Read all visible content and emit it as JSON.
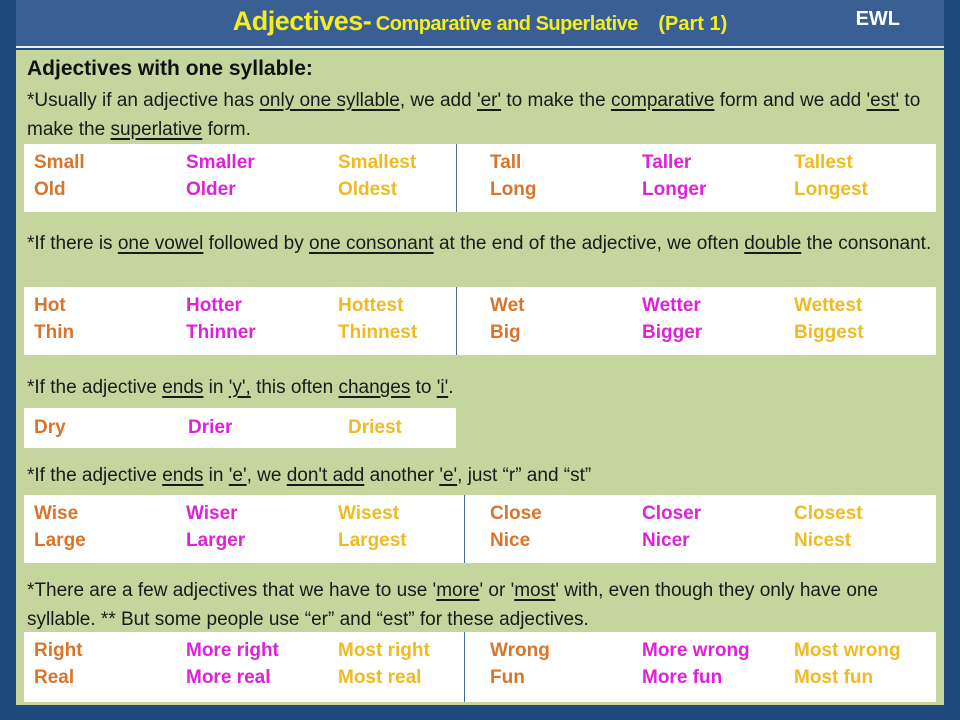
{
  "header": {
    "title_main": "Adjectives-",
    "title_sub": "Comparative and Superlative",
    "title_part": "(Part 1)",
    "brand": "EWL"
  },
  "colors": {
    "background": "#1f4a7d",
    "header": "#3a5f95",
    "title": "#f5ee1e",
    "panel": "#c4d69e",
    "base_form": "#d8752a",
    "comparative_form": "#dd22d8",
    "superlative_form": "#f0bb22"
  },
  "heading": "Adjectives with one syllable:",
  "rules": [
    {
      "segments": [
        {
          "text": "*Usually if an adjective has ",
          "u": false
        },
        {
          "text": "only one syllable",
          "u": true
        },
        {
          "text": ", we add ",
          "u": false
        },
        {
          "text": "'er'",
          "u": true
        },
        {
          "text": " to make the ",
          "u": false
        },
        {
          "text": "comparative",
          "u": true
        },
        {
          "text": " form and we add ",
          "u": false
        },
        {
          "text": "'est'",
          "u": true
        },
        {
          "text": " to make the ",
          "u": false
        },
        {
          "text": "superlative",
          "u": true
        },
        {
          "text": " form.",
          "u": false
        }
      ],
      "rows": [
        [
          "Small",
          "Smaller",
          "Smallest",
          "Tall",
          "Taller",
          "Tallest"
        ],
        [
          "Old",
          "Older",
          "Oldest",
          "Long",
          "Longer",
          "Longest"
        ]
      ]
    },
    {
      "segments": [
        {
          "text": "*If there is ",
          "u": false
        },
        {
          "text": "one vowel",
          "u": true
        },
        {
          "text": " followed by ",
          "u": false
        },
        {
          "text": "one consonant",
          "u": true
        },
        {
          "text": " at the end of the adjective, we often ",
          "u": false
        },
        {
          "text": "double",
          "u": true
        },
        {
          "text": " the consonant.",
          "u": false
        }
      ],
      "rows": [
        [
          "Hot",
          "Hotter",
          "Hottest",
          "Wet",
          "Wetter",
          "Wettest"
        ],
        [
          "Thin",
          "Thinner",
          "Thinnest",
          "Big",
          "Bigger",
          "Biggest"
        ]
      ]
    },
    {
      "segments": [
        {
          "text": "*If the adjective ",
          "u": false
        },
        {
          "text": "ends",
          "u": true
        },
        {
          "text": " in ",
          "u": false
        },
        {
          "text": "'y',",
          "u": true
        },
        {
          "text": " this often ",
          "u": false
        },
        {
          "text": "changes",
          "u": true
        },
        {
          "text": " to ",
          "u": false
        },
        {
          "text": "'i'",
          "u": true
        },
        {
          "text": ".",
          "u": false
        }
      ],
      "rows": [
        [
          "Dry",
          "Drier",
          "Driest"
        ]
      ]
    },
    {
      "segments": [
        {
          "text": "*If the adjective ",
          "u": false
        },
        {
          "text": "ends",
          "u": true
        },
        {
          "text": " in ",
          "u": false
        },
        {
          "text": "'e'",
          "u": true
        },
        {
          "text": ", we ",
          "u": false
        },
        {
          "text": "don't add",
          "u": true
        },
        {
          "text": " another ",
          "u": false
        },
        {
          "text": "'e'",
          "u": true
        },
        {
          "text": ", just “r” and “st”",
          "u": false
        }
      ],
      "rows": [
        [
          "Wise",
          "Wiser",
          "Wisest",
          "Close",
          "Closer",
          "Closest"
        ],
        [
          "Large",
          "Larger",
          "Largest",
          "Nice",
          "Nicer",
          "Nicest"
        ]
      ]
    },
    {
      "segments": [
        {
          "text": "*There are a few adjectives that we have to use '",
          "u": false
        },
        {
          "text": "more",
          "u": true
        },
        {
          "text": "' or '",
          "u": false
        },
        {
          "text": "most",
          "u": true
        },
        {
          "text": "' with, even though they only have one syllable.  ** But some people use “er” and “est” for these adjectives.",
          "u": false
        }
      ],
      "rows": [
        [
          "Right",
          "More right",
          "Most right",
          "Wrong",
          "More wrong",
          "Most wrong"
        ],
        [
          "Real",
          "More real",
          "Most real",
          "Fun",
          "More fun",
          "Most fun"
        ]
      ]
    }
  ]
}
